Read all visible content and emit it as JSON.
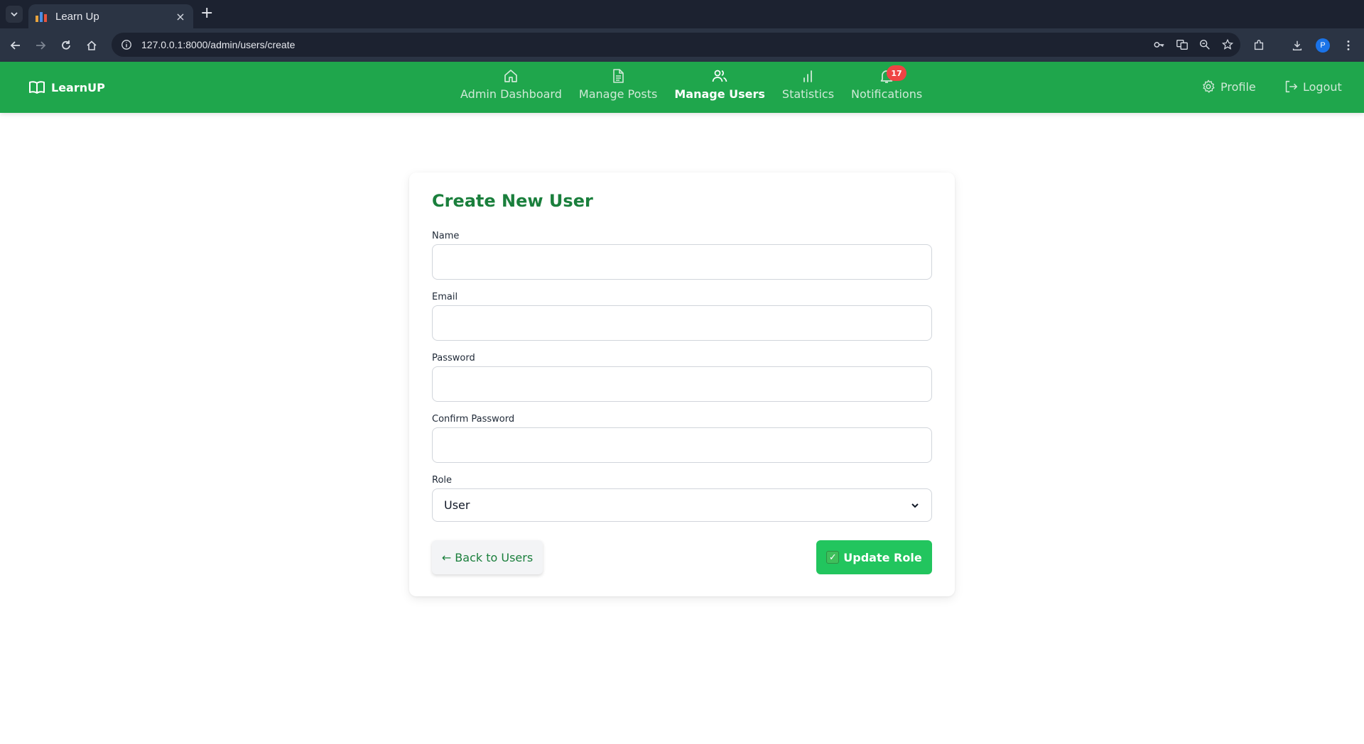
{
  "browser": {
    "tab_title": "Learn Up",
    "tab_close": "×",
    "new_tab": "+",
    "url": "127.0.0.1:8000/admin/users/create",
    "profile_initial": "P"
  },
  "app": {
    "brand": "LearnUP",
    "nav": [
      {
        "label": "Admin Dashboard",
        "icon": "home-icon",
        "active": false
      },
      {
        "label": "Manage Posts",
        "icon": "document-icon",
        "active": false
      },
      {
        "label": "Manage Users",
        "icon": "users-icon",
        "active": true
      },
      {
        "label": "Statistics",
        "icon": "bar-chart-icon",
        "active": false
      },
      {
        "label": "Notifications",
        "icon": "bell-icon",
        "active": false,
        "badge": "17"
      }
    ],
    "profile_label": "Profile",
    "logout_label": "Logout",
    "colors": {
      "navbar": "#1fa64c",
      "accent": "#1a7f3c",
      "button": "#22c55e",
      "badge": "#ef4444"
    }
  },
  "form": {
    "title": "Create New User",
    "name_label": "Name",
    "name_value": "",
    "email_label": "Email",
    "email_value": "",
    "password_label": "Password",
    "password_value": "",
    "confirm_label": "Confirm Password",
    "confirm_value": "",
    "role_label": "Role",
    "role_selected": "User",
    "back_button": "← Back to Users",
    "submit_button": "Update Role",
    "submit_icon": "✓"
  }
}
